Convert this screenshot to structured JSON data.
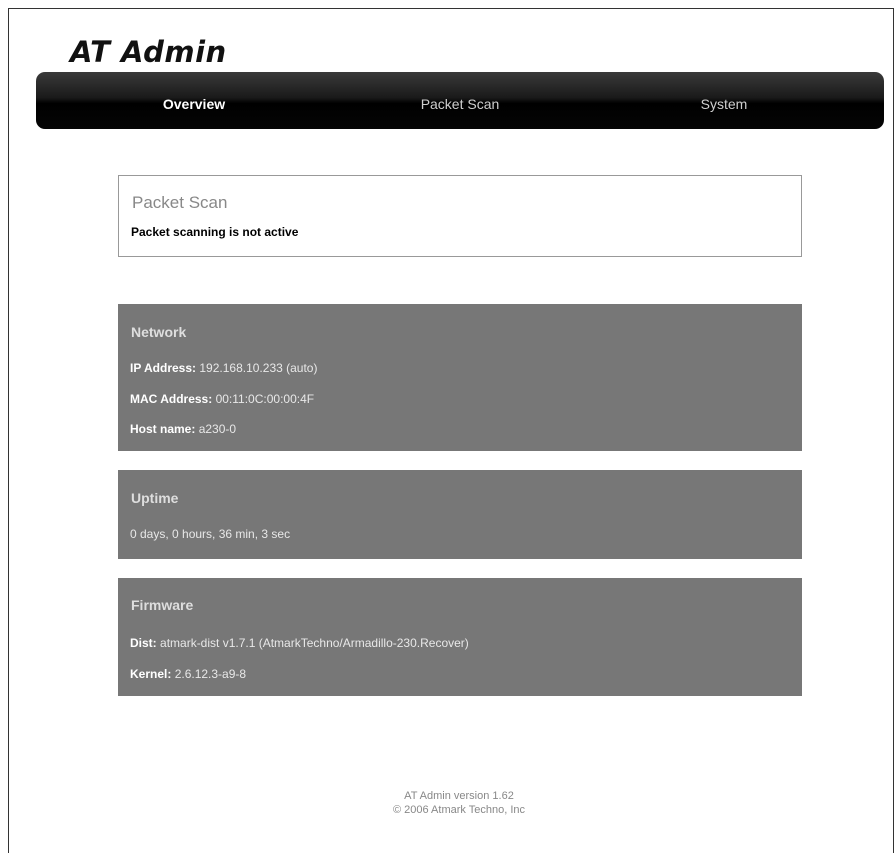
{
  "header": {
    "logo_text": "AT Admin"
  },
  "nav": {
    "items": [
      {
        "label": "Overview",
        "active": true
      },
      {
        "label": "Packet Scan",
        "active": false
      },
      {
        "label": "System",
        "active": false
      }
    ]
  },
  "packet_scan": {
    "title": "Packet Scan",
    "status": "Packet scanning is not active"
  },
  "network": {
    "title": "Network",
    "ip_label": "IP Address:",
    "ip_value": "192.168.10.233 (auto)",
    "mac_label": "MAC Address:",
    "mac_value": "00:11:0C:00:00:4F",
    "host_label": "Host name:",
    "host_value": "a230-0"
  },
  "uptime": {
    "title": "Uptime",
    "value": "0 days, 0 hours, 36 min, 3 sec"
  },
  "firmware": {
    "title": "Firmware",
    "dist_label": "Dist:",
    "dist_value": "atmark-dist v1.7.1 (AtmarkTechno/Armadillo-230.Recover)",
    "kernel_label": "Kernel:",
    "kernel_value": "2.6.12.3-a9-8"
  },
  "footer": {
    "version": "AT Admin version 1.62",
    "copyright": "© 2006 Atmark Techno, Inc"
  },
  "colors": {
    "navbar": "#000000",
    "panel_gray": "#777777",
    "active_nav_text": "#ffffff"
  }
}
